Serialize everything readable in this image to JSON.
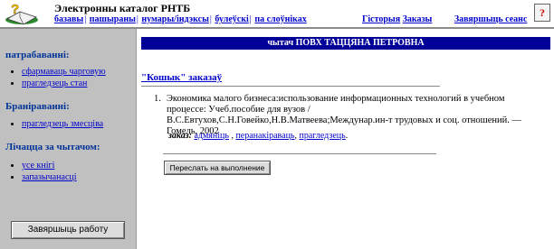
{
  "header": {
    "title": "Электронны каталог РНТБ",
    "nav": [
      "базавы",
      "пашыраны",
      "нумары/індэксы",
      "булеўскі",
      "па слоўніках"
    ],
    "history_link": "Гісторыя",
    "orders_link": "Заказы",
    "logout_link": "Завяршыць сеанс",
    "help_glyph": "?"
  },
  "sidebar": {
    "requests_heading": "патрабаванні:",
    "requests_items": [
      "сфармаваць чарговую",
      "прагледзець стан"
    ],
    "booking_heading": "Браніраванні:",
    "booking_items": [
      "прагледзець змесціва"
    ],
    "reader_heading": "Лічацца за чытачом:",
    "reader_items": [
      "усе кнігі",
      "запазычанасці"
    ],
    "logout_button": "Завяршыць работу"
  },
  "main": {
    "reader_bar": "чытач ПОВХ ТАЦЦЯНА ПЕТРОВНА",
    "cart_title": "\"Кошык\" заказаў",
    "order": {
      "number": "1.",
      "text": "Экономика малого бизнеса:использование информационных технологий в учебном процессе: Учеб.пособие для вузов / В.С.Евтухов,С.Н.Говейко,Н.В.Матвеева;Междунар.ин-т трудовых и соц. отношений. — Гомель, 2002",
      "actions_label": "заказ:",
      "action_cancel": "адмяніць",
      "action_redirect": "перанакіраваць",
      "action_view": "прагледзець"
    },
    "forward_button": "Переслать на выполнение"
  },
  "colors": {
    "reader_bar_bg": "#000099",
    "sidebar_bg": "#c0c0c0",
    "link": "#0000cc"
  }
}
